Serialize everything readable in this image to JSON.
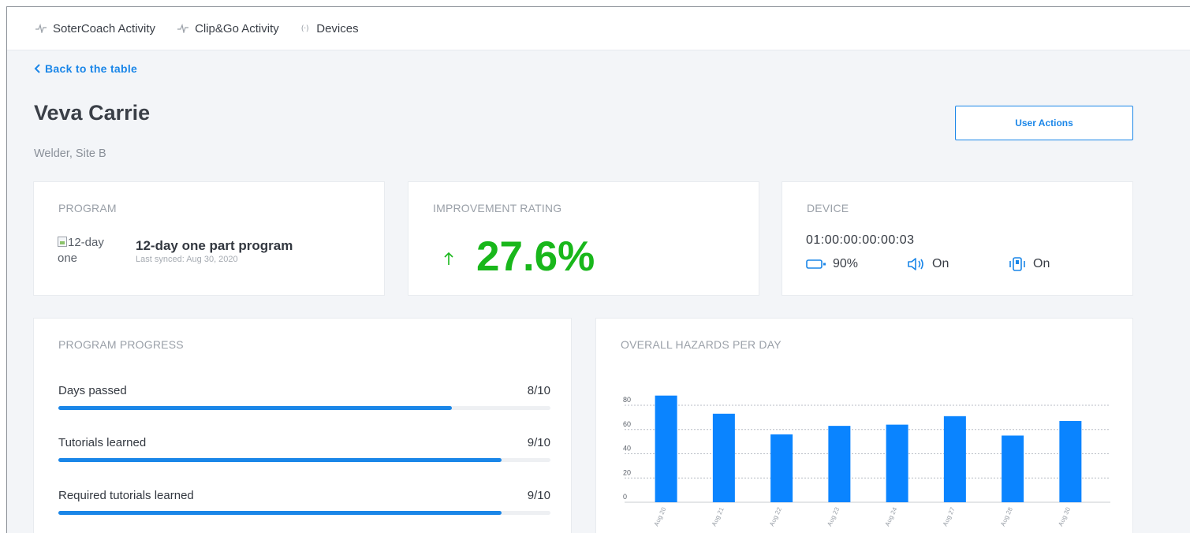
{
  "nav": {
    "items": [
      {
        "label": "SoterCoach Activity",
        "icon": "activity-icon"
      },
      {
        "label": "Clip&Go Activity",
        "icon": "activity-icon"
      },
      {
        "label": "Devices",
        "icon": "devices-icon"
      }
    ],
    "devices_icon_glyph": "(·)"
  },
  "back_link": "Back to the table",
  "user": {
    "name": "Veva Carrie",
    "role": "Welder, Site B"
  },
  "user_actions_label": "User Actions",
  "program_card": {
    "title": "PROGRAM",
    "image_alt": "12-day one",
    "program_name": "12-day one part program",
    "last_synced": "Last synced: Aug 30, 2020"
  },
  "rating_card": {
    "title": "IMPROVEMENT RATING",
    "value": "27.6%",
    "trend": "up",
    "color": "#19b71b"
  },
  "device_card": {
    "title": "DEVICE",
    "device_id": "01:00:00:00:00:03",
    "battery": "90%",
    "sound": "On",
    "vibration": "On"
  },
  "progress_card": {
    "title": "PROGRAM PROGRESS",
    "rows": [
      {
        "label": "Days passed",
        "count": "8/10",
        "fraction": 0.8
      },
      {
        "label": "Tutorials learned",
        "count": "9/10",
        "fraction": 0.9
      },
      {
        "label": "Required tutorials learned",
        "count": "9/10",
        "fraction": 0.9
      }
    ]
  },
  "hazards_card": {
    "title": "OVERALL HAZARDS PER DAY"
  },
  "chart_data": {
    "type": "bar",
    "title": "OVERALL HAZARDS PER DAY",
    "categories": [
      "Aug 20",
      "Aug 21",
      "Aug 22",
      "Aug 23",
      "Aug 24",
      "Aug 27",
      "Aug 28",
      "Aug 30"
    ],
    "values": [
      88,
      73,
      56,
      63,
      64,
      71,
      55,
      67
    ],
    "yticks": [
      "0",
      "20",
      "40",
      "60",
      "80"
    ],
    "ylim": [
      0,
      80
    ],
    "grid": true,
    "bar_color": "#0a84ff"
  },
  "colors": {
    "accent": "#1a86e8",
    "positive": "#19b71b"
  }
}
